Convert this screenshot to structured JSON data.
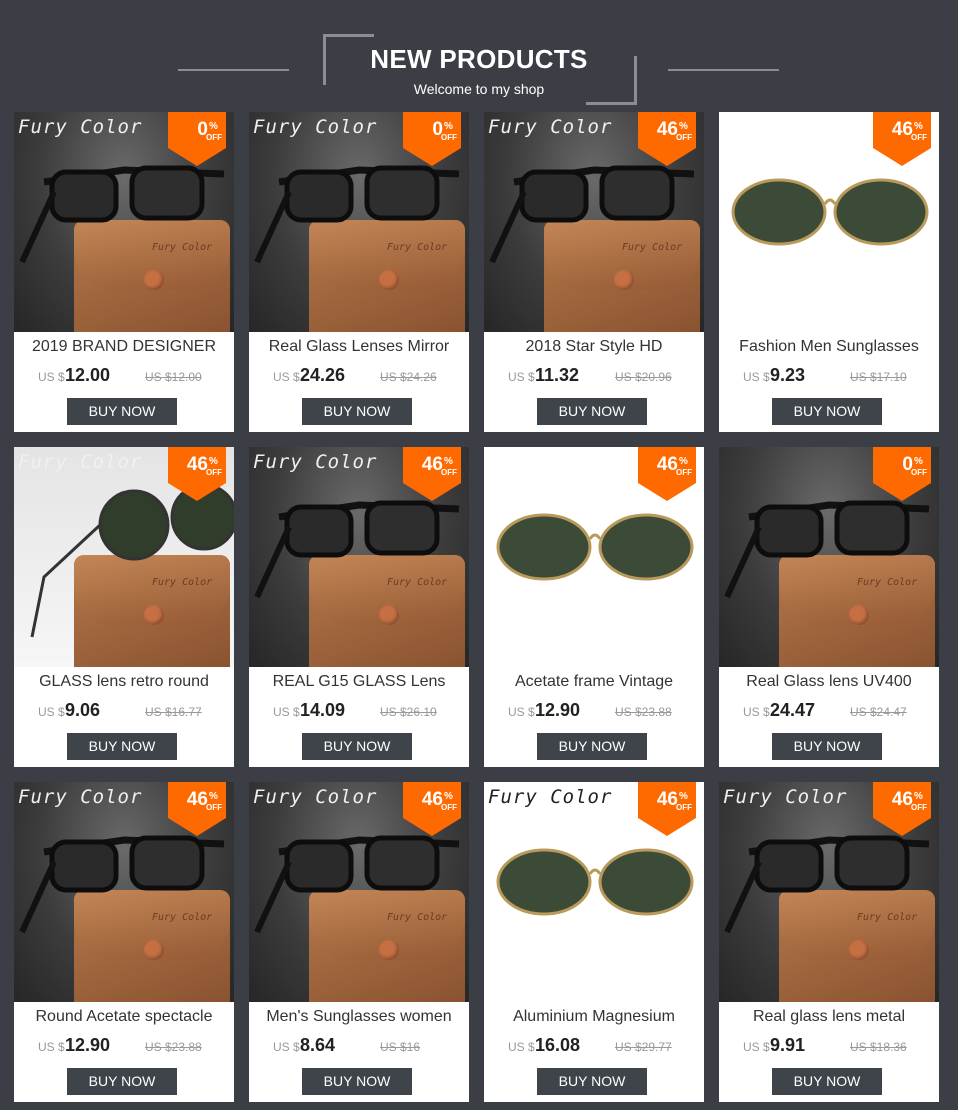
{
  "header": {
    "title": "NEW PRODUCTS",
    "subtitle": "Welcome to my shop"
  },
  "colors": {
    "background": "#3b3e44",
    "badge": "#ff6a00",
    "button": "#3f434a"
  },
  "buy_label": "BUY NOW",
  "currency_label": "US $",
  "products": [
    {
      "name": "2019 BRAND DESIGNER",
      "price": "12.00",
      "old_price": "US $12.00",
      "discount": "0",
      "pct": "%",
      "off": "OFF",
      "brand": "Fury Color",
      "photo": "dark"
    },
    {
      "name": "Real Glass Lenses Mirror",
      "price": "24.26",
      "old_price": "US $24.26",
      "discount": "0",
      "pct": "%",
      "off": "OFF",
      "brand": "Fury Color",
      "photo": "dark"
    },
    {
      "name": "2018 Star Style HD",
      "price": "11.32",
      "old_price": "US $20.96",
      "discount": "46",
      "pct": "%",
      "off": "OFF",
      "brand": "Fury Color",
      "photo": "dark"
    },
    {
      "name": "Fashion Men Sunglasses",
      "price": "9.23",
      "old_price": "US $17.10",
      "discount": "46",
      "pct": "%",
      "off": "OFF",
      "brand": "",
      "photo": "white"
    },
    {
      "name": "GLASS lens retro round",
      "price": "9.06",
      "old_price": "US $16.77",
      "discount": "46",
      "pct": "%",
      "off": "OFF",
      "brand": "Fury Color",
      "photo": "light"
    },
    {
      "name": "REAL G15 GLASS Lens",
      "price": "14.09",
      "old_price": "US $26.10",
      "discount": "46",
      "pct": "%",
      "off": "OFF",
      "brand": "Fury Color",
      "photo": "dark"
    },
    {
      "name": "Acetate frame Vintage",
      "price": "12.90",
      "old_price": "US $23.88",
      "discount": "46",
      "pct": "%",
      "off": "OFF",
      "brand": "",
      "photo": "white"
    },
    {
      "name": "Real Glass lens UV400",
      "price": "24.47",
      "old_price": "US $24.47",
      "discount": "0",
      "pct": "%",
      "off": "OFF",
      "brand": "",
      "photo": "dark"
    },
    {
      "name": "Round Acetate spectacle",
      "price": "12.90",
      "old_price": "US $23.88",
      "discount": "46",
      "pct": "%",
      "off": "OFF",
      "brand": "Fury Color",
      "photo": "dark"
    },
    {
      "name": "Men's Sunglasses women",
      "price": "8.64",
      "old_price": "US $16",
      "discount": "46",
      "pct": "%",
      "off": "OFF",
      "brand": "Fury Color",
      "photo": "dark"
    },
    {
      "name": "Aluminium Magnesium",
      "price": "16.08",
      "old_price": "US $29.77",
      "discount": "46",
      "pct": "%",
      "off": "OFF",
      "brand": "Fury Color",
      "photo": "white"
    },
    {
      "name": "Real glass lens metal",
      "price": "9.91",
      "old_price": "US $18.36",
      "discount": "46",
      "pct": "%",
      "off": "OFF",
      "brand": "Fury Color",
      "photo": "dark"
    }
  ]
}
